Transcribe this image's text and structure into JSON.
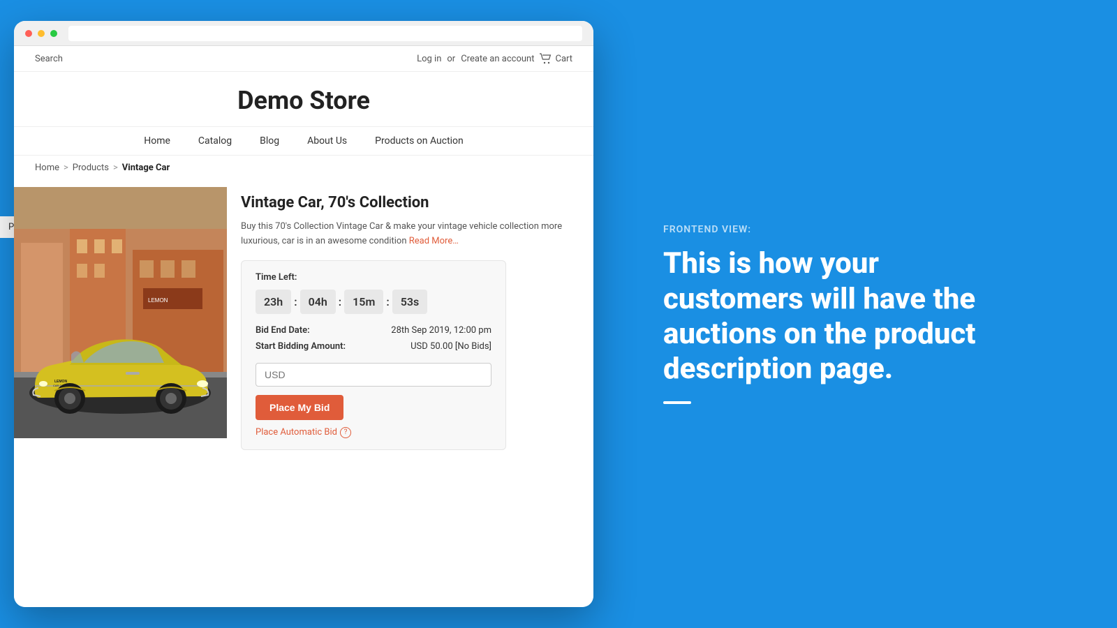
{
  "page": {
    "background_color": "#1a8fe3"
  },
  "browser": {
    "dots": [
      "red",
      "yellow",
      "green"
    ]
  },
  "store": {
    "search_placeholder": "Search",
    "topbar": {
      "login": "Log in",
      "or": "or",
      "create_account": "Create an account",
      "cart": "Cart"
    },
    "title": "Demo Store",
    "nav": {
      "items": [
        {
          "label": "Home",
          "id": "home"
        },
        {
          "label": "Catalog",
          "id": "catalog"
        },
        {
          "label": "Blog",
          "id": "blog"
        },
        {
          "label": "About Us",
          "id": "about"
        },
        {
          "label": "Products on Auction",
          "id": "auction"
        }
      ]
    },
    "breadcrumb": {
      "home": "Home",
      "products": "Products",
      "current": "Vintage Car"
    },
    "product": {
      "title": "Vintage Car, 70's Collection",
      "description": "Buy this 70's Collection Vintage Car & make your vintage vehicle collection more luxurious, car is in an awesome condition",
      "read_more": "Read More…",
      "auction": {
        "time_left_label": "Time Left:",
        "countdown": {
          "hours": "23h",
          "sep1": ":",
          "minutes": "04h",
          "sep2": ":",
          "seconds": "15m",
          "sep3": ":",
          "ms": "53s"
        },
        "bid_end_label": "Bid End Date:",
        "bid_end_value": "28th Sep 2019, 12:00 pm",
        "start_bid_label": "Start Bidding Amount:",
        "start_bid_value": "USD 50.00  [No Bids]",
        "input_placeholder": "USD",
        "place_bid_button": "Place My Bid",
        "automatic_bid": "Place Automatic Bid",
        "help_icon": "?"
      }
    }
  },
  "sidebar": {
    "products_label": "Products"
  },
  "right_panel": {
    "frontend_label": "FRONTEND VIEW:",
    "heading_line1": "This is how your",
    "heading_line2": "customers will have the",
    "heading_line3": "auctions on the product",
    "heading_line4": "description page."
  }
}
